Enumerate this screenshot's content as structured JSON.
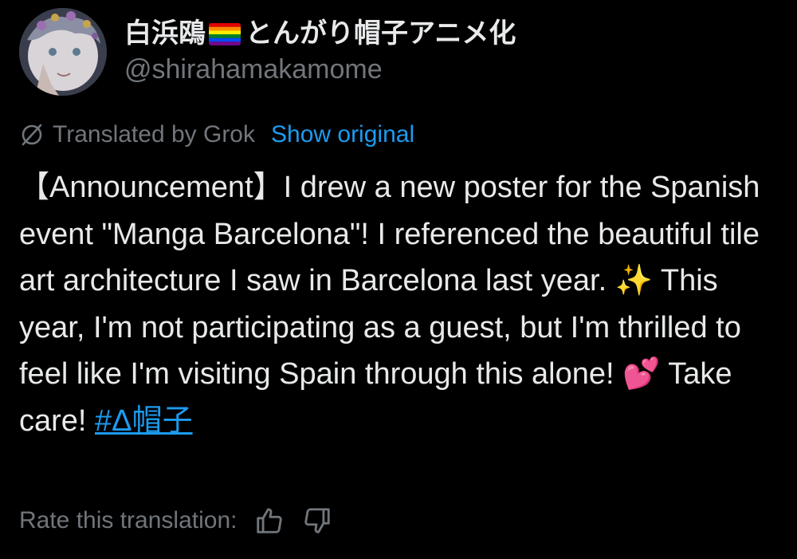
{
  "user": {
    "display_name": "白浜鴎",
    "display_name_suffix": "とんがり帽子アニメ化",
    "handle": "@shirahamakamome",
    "flag_emoji": "rainbow-flag-icon"
  },
  "translation_bar": {
    "label": "Translated by Grok",
    "show_original": "Show original",
    "icon": "grok-icon"
  },
  "tweet": {
    "body": "【Announcement】I drew a new poster for the Spanish event \"Manga Barcelona\"! I referenced the beautiful tile art architecture I saw in Barcelona last year. ✨ This year, I'm not participating as a guest, but I'm thrilled to feel like I'm visiting Spain through this alone! 💕 Take care! ",
    "hashtag": "#Δ帽子"
  },
  "rating": {
    "label": "Rate this translation:",
    "thumbs_up_icon": "thumbs-up-icon",
    "thumbs_down_icon": "thumbs-down-icon"
  },
  "colors": {
    "background": "#000000",
    "text_primary": "#e7e9ea",
    "text_secondary": "#71767b",
    "link": "#1d9bf0"
  }
}
